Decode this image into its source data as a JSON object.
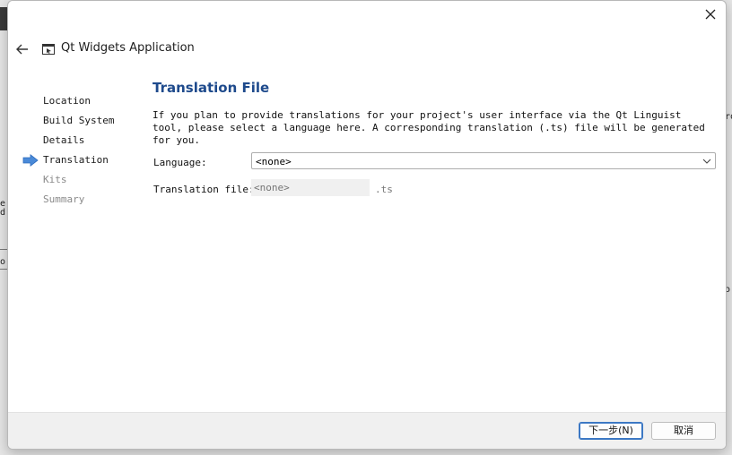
{
  "wizard": {
    "title": "Qt Widgets Application",
    "steps": [
      {
        "label": "Location",
        "state": "done"
      },
      {
        "label": "Build System",
        "state": "done"
      },
      {
        "label": "Details",
        "state": "done"
      },
      {
        "label": "Translation",
        "state": "current"
      },
      {
        "label": "Kits",
        "state": "pending"
      },
      {
        "label": "Summary",
        "state": "pending"
      }
    ]
  },
  "page": {
    "title": "Translation File",
    "description": "If you plan to provide translations for your project's user interface via the Qt Linguist tool, please select a language here. A corresponding translation (.ts) file will be generated for you.",
    "language_label": "Language:",
    "language_value": "<none>",
    "file_label": "Translation file:",
    "file_placeholder": "<none>",
    "file_suffix": ".ts"
  },
  "buttons": {
    "next": "下一步(N)",
    "cancel": "取消"
  },
  "background": {
    "frag1": "ro",
    "frag2": "o.",
    "frag3": "o",
    "frag4": "e",
    "frag5": "d"
  },
  "icons": {
    "close": "close-icon",
    "back": "back-arrow-icon",
    "wizard": "window-icon",
    "current_step": "arrow-right-icon",
    "dropdown": "chevron-down-icon"
  },
  "colors": {
    "title_blue": "#1e4a8c",
    "arrow_blue": "#4a8ad8",
    "primary_border": "#3c78c4"
  }
}
